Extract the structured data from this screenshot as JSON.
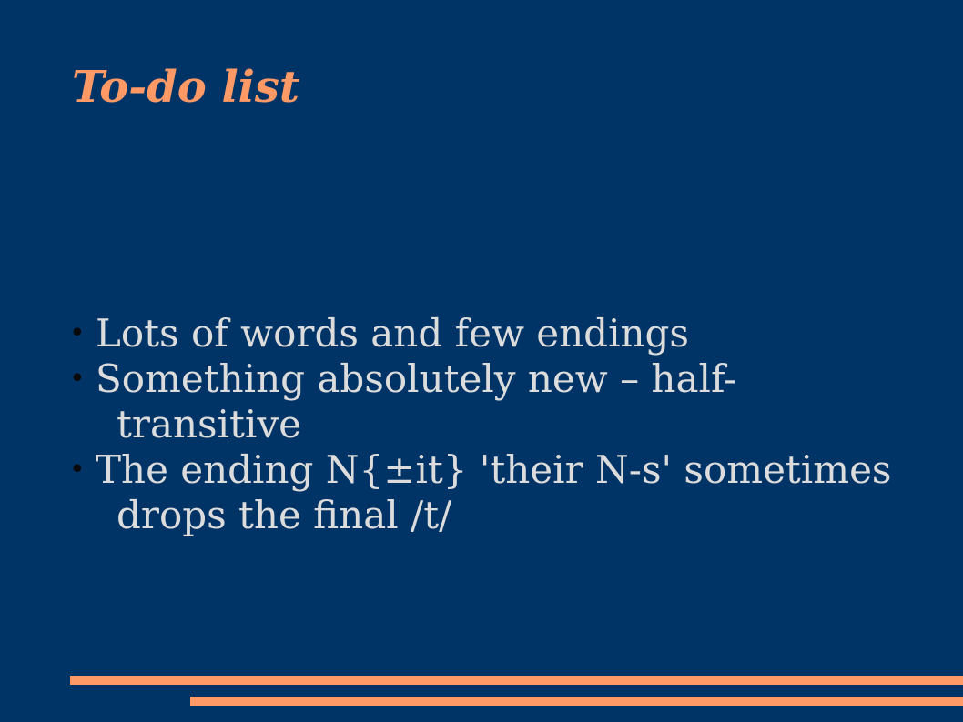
{
  "slide": {
    "title": "To-do list",
    "bullets": [
      {
        "text": "Lots of words and few endings"
      },
      {
        "text": "Something absolutely new – half-transitive"
      },
      {
        "text": "The ending N{±it} 'their N-s' sometimes drops the final /t/"
      }
    ]
  },
  "colors": {
    "background": "#003366",
    "title": "#ff9966",
    "body_text": "#dcdcdc",
    "bullet_glyph": "#0a0a0a",
    "accent_rule": "#ff9966"
  },
  "icons": {
    "bullet": "bullet-dot-icon"
  }
}
